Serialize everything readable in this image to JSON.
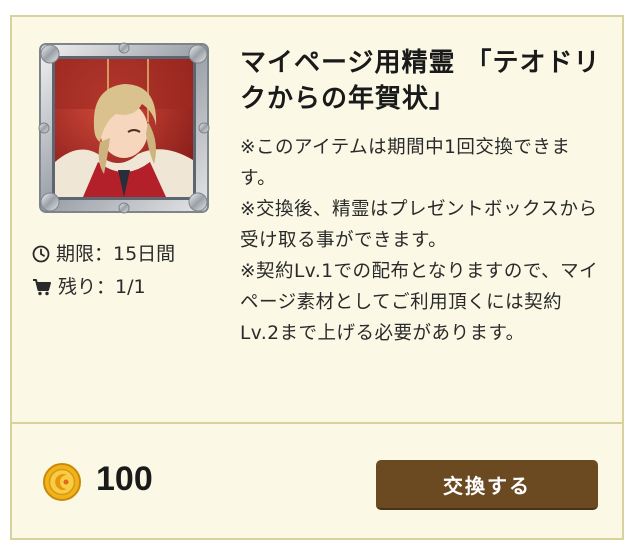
{
  "item": {
    "title": "マイページ用精霊 「テオドリクからの年賀状」",
    "description": "※このアイテムは期間中1回交換できます。\n※交換後、精霊はプレゼントボックスから受け取る事ができます。\n※契約Lv.1での配布となりますので、マイページ素材としてご利用頂くには契約Lv.2まで上げる必要があります。",
    "period": "期限：15日間",
    "remaining": "残り：1/1",
    "image_icon": "character-portrait"
  },
  "purchase": {
    "price": "100",
    "currency_icon": "gold-coin-icon",
    "button_label": "交換する"
  },
  "colors": {
    "card_bg": "#fbf9e6",
    "card_border": "#d8d29e",
    "button_bg": "#6b4a22",
    "coin": "#f2b21a"
  }
}
